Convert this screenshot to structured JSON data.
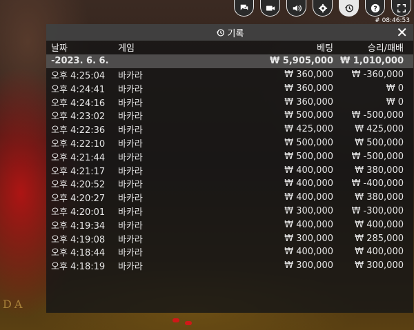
{
  "controls": [
    {
      "name": "chat-icon"
    },
    {
      "name": "video-icon"
    },
    {
      "name": "volume-icon"
    },
    {
      "name": "gear-icon"
    },
    {
      "name": "history-icon",
      "active": true
    },
    {
      "name": "help-icon"
    },
    {
      "name": "fullscreen-icon"
    }
  ],
  "clock": "# 08:46:53",
  "history": {
    "title": "기록",
    "close": "✕",
    "columns": {
      "date": "날짜",
      "game": "게임",
      "bet": "베팅",
      "win": "승리/패배"
    },
    "summary": {
      "date": "-2023. 6. 6.",
      "game": "",
      "bet": "₩ 5,905,000",
      "win": "₩ 1,010,000"
    },
    "rows": [
      {
        "date": "오후 4:25:04",
        "game": "바카라",
        "bet": "₩ 360,000",
        "win": "₩ -360,000"
      },
      {
        "date": "오후 4:24:41",
        "game": "바카라",
        "bet": "₩ 360,000",
        "win": "₩ 0"
      },
      {
        "date": "오후 4:24:16",
        "game": "바카라",
        "bet": "₩ 360,000",
        "win": "₩ 0"
      },
      {
        "date": "오후 4:23:02",
        "game": "바카라",
        "bet": "₩ 500,000",
        "win": "₩ -500,000"
      },
      {
        "date": "오후 4:22:36",
        "game": "바카라",
        "bet": "₩ 425,000",
        "win": "₩ 425,000"
      },
      {
        "date": "오후 4:22:10",
        "game": "바카라",
        "bet": "₩ 500,000",
        "win": "₩ 500,000"
      },
      {
        "date": "오후 4:21:44",
        "game": "바카라",
        "bet": "₩ 500,000",
        "win": "₩ -500,000"
      },
      {
        "date": "오후 4:21:17",
        "game": "바카라",
        "bet": "₩ 400,000",
        "win": "₩ 380,000"
      },
      {
        "date": "오후 4:20:52",
        "game": "바카라",
        "bet": "₩ 400,000",
        "win": "₩ -400,000"
      },
      {
        "date": "오후 4:20:27",
        "game": "바카라",
        "bet": "₩ 400,000",
        "win": "₩ 380,000"
      },
      {
        "date": "오후 4:20:01",
        "game": "바카라",
        "bet": "₩ 300,000",
        "win": "₩ -300,000"
      },
      {
        "date": "오후 4:19:34",
        "game": "바카라",
        "bet": "₩ 400,000",
        "win": "₩ 400,000"
      },
      {
        "date": "오후 4:19:08",
        "game": "바카라",
        "bet": "₩ 300,000",
        "win": "₩ 285,000"
      },
      {
        "date": "오후 4:18:44",
        "game": "바카라",
        "bet": "₩ 400,000",
        "win": "₩ 400,000"
      },
      {
        "date": "오후 4:18:19",
        "game": "바카라",
        "bet": "₩ 300,000",
        "win": "₩ 300,000"
      }
    ]
  },
  "background": {
    "table_text": "DA"
  }
}
